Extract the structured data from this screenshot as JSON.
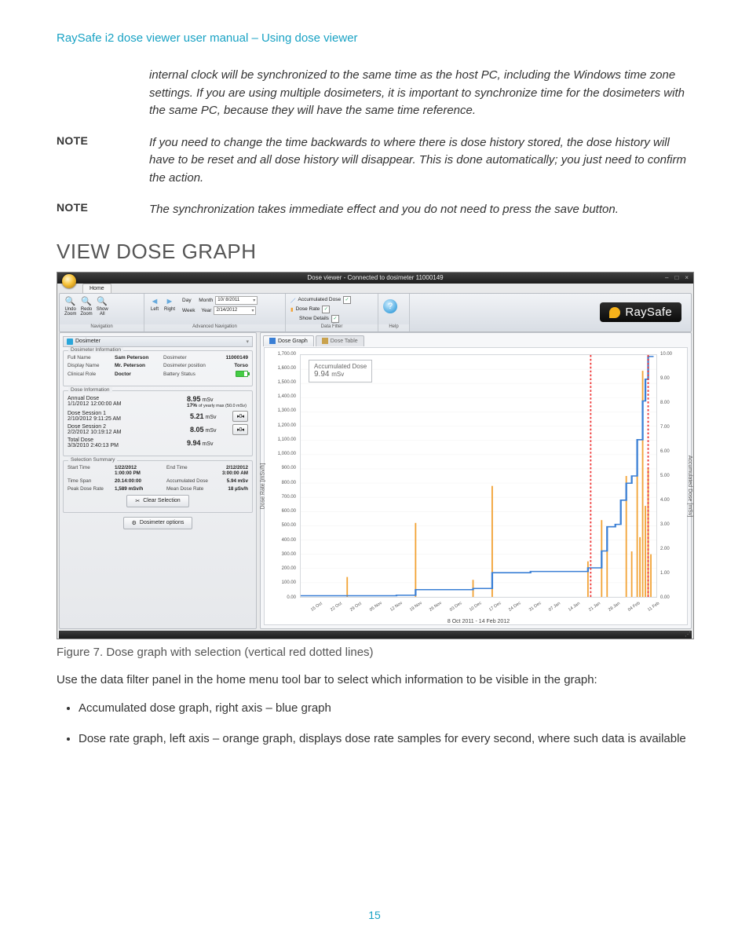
{
  "page": {
    "running_head": "RaySafe i2 dose viewer user manual – Using dose viewer",
    "number": "15"
  },
  "intro_continued": "internal clock will be synchronized to the same time as the host PC, including the Windows time zone settings. If you are using multiple dosimeters, it is important to synchronize time for the dosimeters with the same PC, because they will have the same time reference.",
  "notes": [
    {
      "label": "NOTE",
      "text": "If you need to change the time backwards to where there is dose history stored, the dose history will have to be reset and all dose history will disappear. This is done automatically; you just need to confirm the action."
    },
    {
      "label": "NOTE",
      "text": "The synchronization takes immediate effect and you do not need to press the save button."
    }
  ],
  "section_title": "VIEW DOSE GRAPH",
  "app": {
    "title": "Dose viewer - Connected to dosimeter 11000149",
    "home_tab": "Home",
    "ribbon": {
      "nav": {
        "undo": "Undo\nZoom",
        "redo": "Redo\nZoom",
        "show_all": "Show\nAll",
        "caption": "Navigation"
      },
      "advnav": {
        "left": "Left",
        "right": "Right",
        "day": "Day",
        "month": "Month",
        "week": "Week",
        "year": "Year",
        "date1": "10/ 8/2011",
        "date2": "2/14/2012",
        "caption": "Advanced Navigation"
      },
      "filter": {
        "acc": "Accumulated Dose",
        "rate": "Dose Rate",
        "details": "Show Details",
        "caption": "Data Filter"
      },
      "help": {
        "caption": "Help"
      }
    },
    "logo": "RaySafe",
    "side": {
      "header": "Dosimeter",
      "info_legend": "Dosimeter Information",
      "info": {
        "full_name_k": "Full Name",
        "full_name_v": "Sam Peterson",
        "dosimeter_k": "Dosimeter",
        "dosimeter_v": "11000149",
        "display_k": "Display Name",
        "display_v": "Mr. Peterson",
        "pos_k": "Dosimeter position",
        "pos_v": "Torso",
        "role_k": "Clinical Role",
        "role_v": "Doctor",
        "batt_k": "Battery Status"
      },
      "dose_legend": "Dose Information",
      "dose": {
        "annual_k": "Annual Dose",
        "annual_sub": "1/1/2012 12:00:00 AM",
        "annual_v": "8.95",
        "annual_u": "mSv",
        "pct": "17%",
        "pct_sub": "of yearly max (50.0 mSv)",
        "s1_k": "Dose Session 1",
        "s1_sub": "2/10/2012 9:11:25 AM",
        "s1_v": "5.21",
        "s1_u": "mSv",
        "s2_k": "Dose Session 2",
        "s2_sub": "2/2/2012 10:19:12 AM",
        "s2_v": "8.05",
        "s2_u": "mSv",
        "tot_k": "Total Dose",
        "tot_sub": "3/3/2010 2:40:13 PM",
        "tot_v": "9.94",
        "tot_u": "mSv"
      },
      "sel_legend": "Selection Summary",
      "sel": {
        "start_k": "Start Time",
        "start_v": "1/22/2012",
        "start_v2": "1:00:00 PM",
        "end_k": "End Time",
        "end_v": "2/12/2012",
        "end_v2": "3:00:00 AM",
        "span_k": "Time Span",
        "span_v": "20.14:00:00",
        "accd_k": "Accumulated Dose",
        "accd_v": "5.94 mSv",
        "peak_k": "Peak Dose Rate",
        "peak_v": "1,589 mSv/h",
        "mean_k": "Mean Dose Rate",
        "mean_v": "18 µSv/h"
      },
      "clear_btn": "Clear Selection",
      "opts_btn": "Dosimeter options"
    },
    "tabs": {
      "graph": "Dose Graph",
      "table": "Dose Table"
    },
    "chart": {
      "callout_t": "Accumulated Dose",
      "callout_v": "9.94",
      "callout_u": "mSv",
      "y_left_label": "Dose Rate [mSv/h]",
      "y_right_label": "Accumulated Dose [mSv]",
      "x_title": "8 Oct 2011 - 14 Feb 2012"
    }
  },
  "figure_caption": "Figure 7.     Dose graph with selection (vertical red dotted lines)",
  "para_after": "Use the data filter panel in the home menu tool bar to select which information to be visible in the graph:",
  "bullets": [
    "Accumulated dose graph, right axis – blue graph",
    "Dose rate graph, left axis – orange graph, displays dose rate samples for every second, where such data is available"
  ],
  "chart_data": {
    "type": "combo",
    "x_title": "8 Oct 2011 - 14 Feb 2012",
    "x_ticks": [
      "15 Oct",
      "22 Oct",
      "29 Oct",
      "05 Nov",
      "12 Nov",
      "19 Nov",
      "26 Nov",
      "03 Dec",
      "10 Dec",
      "17 Dec",
      "24 Dec",
      "31 Dec",
      "07 Jan",
      "14 Jan",
      "21 Jan",
      "28 Jan",
      "04 Feb",
      "11 Feb"
    ],
    "left_axis": {
      "label": "Dose Rate [mSv/h]",
      "min": 0,
      "max": 1700,
      "step": 100,
      "ticks": [
        "0.00",
        "100.00",
        "200.00",
        "300.00",
        "400.00",
        "500.00",
        "600.00",
        "700.00",
        "800.00",
        "900.00",
        "1,000.00",
        "1,100.00",
        "1,200.00",
        "1,300.00",
        "1,400.00",
        "1,500.00",
        "1,600.00",
        "1,700.00"
      ]
    },
    "right_axis": {
      "label": "Accumulated Dose [mSv]",
      "min": 0,
      "max": 10,
      "step": 1,
      "ticks": [
        "0.00",
        "1.00",
        "2.00",
        "3.00",
        "4.00",
        "5.00",
        "6.00",
        "7.00",
        "8.00",
        "9.00",
        "10.00"
      ]
    },
    "series": [
      {
        "name": "Accumulated Dose",
        "axis": "right",
        "type": "step-line",
        "color": "#3a7fd5",
        "points": [
          [
            "08 Oct",
            0.05
          ],
          [
            "25 Oct",
            0.05
          ],
          [
            "29 Oct",
            0.05
          ],
          [
            "12 Nov",
            0.07
          ],
          [
            "19 Nov",
            0.3
          ],
          [
            "10 Dec",
            0.35
          ],
          [
            "17 Dec",
            1.0
          ],
          [
            "31 Dec",
            1.05
          ],
          [
            "14 Jan",
            1.05
          ],
          [
            "21 Jan",
            1.2
          ],
          [
            "22 Jan",
            1.2
          ],
          [
            "26 Jan",
            1.9
          ],
          [
            "28 Jan",
            2.9
          ],
          [
            "31 Jan",
            3.0
          ],
          [
            "02 Feb",
            4.0
          ],
          [
            "04 Feb",
            4.7
          ],
          [
            "06 Feb",
            5.0
          ],
          [
            "08 Feb",
            6.5
          ],
          [
            "10 Feb",
            8.1
          ],
          [
            "11 Feb",
            9.0
          ],
          [
            "12 Feb",
            9.94
          ],
          [
            "14 Feb",
            9.94
          ]
        ]
      },
      {
        "name": "Dose Rate",
        "axis": "left",
        "type": "bar",
        "color": "#f2a336",
        "points": [
          [
            "25 Oct",
            140
          ],
          [
            "19 Nov",
            520
          ],
          [
            "10 Dec",
            120
          ],
          [
            "17 Dec",
            780
          ],
          [
            "21 Jan",
            250
          ],
          [
            "26 Jan",
            540
          ],
          [
            "28 Jan",
            330
          ],
          [
            "04 Feb",
            850
          ],
          [
            "06 Feb",
            320
          ],
          [
            "08 Feb",
            1100
          ],
          [
            "09 Feb",
            420
          ],
          [
            "10 Feb",
            1589
          ],
          [
            "11 Feb",
            640
          ],
          [
            "12 Feb",
            900
          ],
          [
            "13 Feb",
            300
          ]
        ]
      }
    ],
    "selection": {
      "start": "22 Jan",
      "end": "12 Feb",
      "color": "#e33",
      "style": "dashed"
    },
    "callout": {
      "title": "Accumulated Dose",
      "value": 9.94,
      "unit": "mSv"
    }
  }
}
